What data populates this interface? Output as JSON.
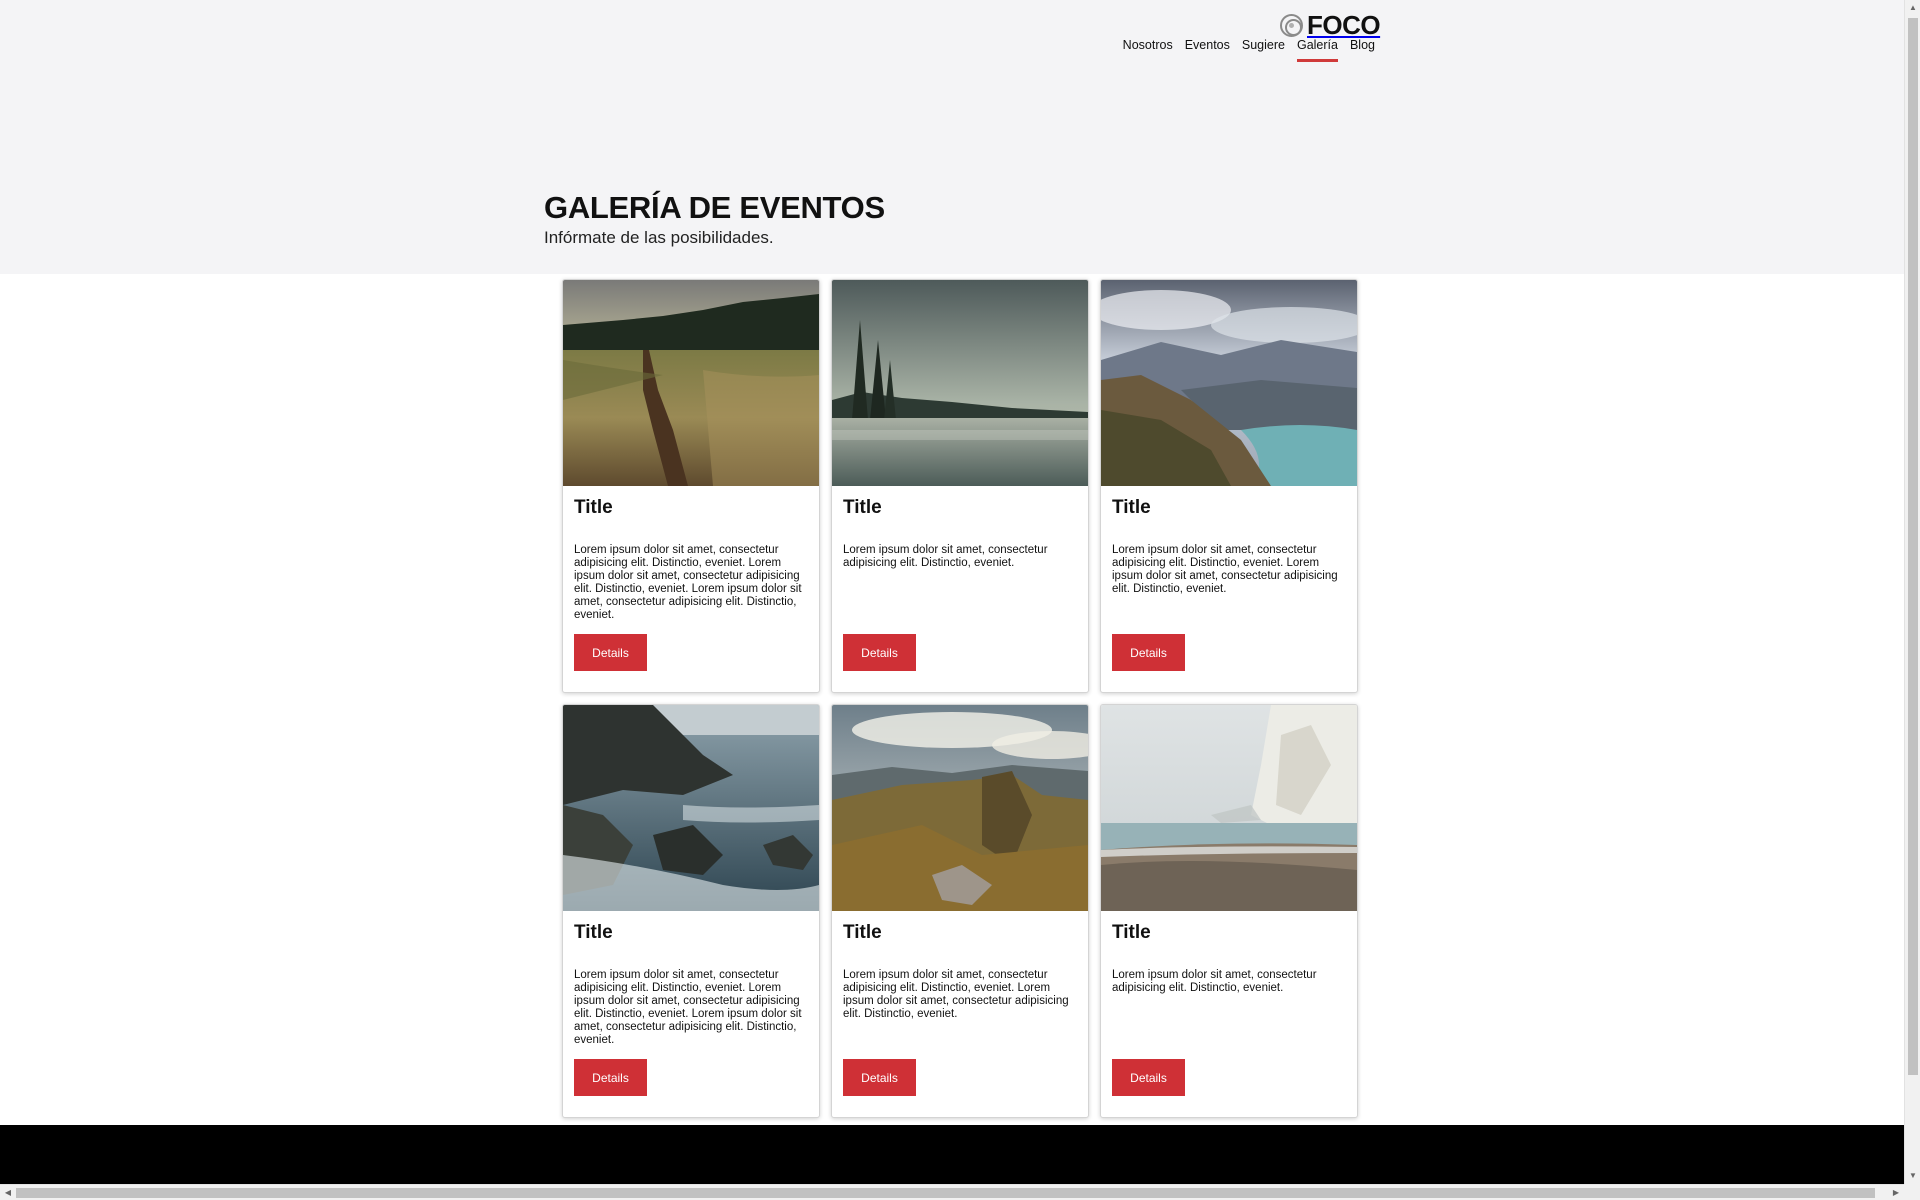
{
  "header": {
    "logo_text": "FOCO",
    "nav": [
      {
        "label": "Nosotros",
        "active": false
      },
      {
        "label": "Eventos",
        "active": false
      },
      {
        "label": "Sugiere",
        "active": false
      },
      {
        "label": "Galería",
        "active": true
      },
      {
        "label": "Blog",
        "active": false
      }
    ]
  },
  "hero": {
    "title": "GALERÍA DE EVENTOS",
    "subtitle": "Infórmate de las posibilidades."
  },
  "cards": [
    {
      "image": "meadow-path-photo",
      "title": "Title",
      "text": "Lorem ipsum dolor sit amet, consectetur adipisicing elit. Distinctio, eveniet. Lorem ipsum dolor sit amet, consectetur adipisicing elit. Distinctio, eveniet. Lorem ipsum dolor sit amet, consectetur adipisicing elit. Distinctio, eveniet.",
      "button": "Details"
    },
    {
      "image": "misty-lake-photo",
      "title": "Title",
      "text": "Lorem ipsum dolor sit amet, consectetur adipisicing elit. Distinctio, eveniet.",
      "button": "Details"
    },
    {
      "image": "mountain-river-photo",
      "title": "Title",
      "text": "Lorem ipsum dolor sit amet, consectetur adipisicing elit. Distinctio, eveniet. Lorem ipsum dolor sit amet, consectetur adipisicing elit. Distinctio, eveniet.",
      "button": "Details"
    },
    {
      "image": "rocky-coast-photo",
      "title": "Title",
      "text": "Lorem ipsum dolor sit amet, consectetur adipisicing elit. Distinctio, eveniet. Lorem ipsum dolor sit amet, consectetur adipisicing elit. Distinctio, eveniet. Lorem ipsum dolor sit amet, consectetur adipisicing elit. Distinctio, eveniet.",
      "button": "Details"
    },
    {
      "image": "hillside-valley-photo",
      "title": "Title",
      "text": "Lorem ipsum dolor sit amet, consectetur adipisicing elit. Distinctio, eveniet. Lorem ipsum dolor sit amet, consectetur adipisicing elit. Distinctio, eveniet.",
      "button": "Details"
    },
    {
      "image": "white-cliff-beach-photo",
      "title": "Title",
      "text": "Lorem ipsum dolor sit amet, consectetur adipisicing elit. Distinctio, eveniet.",
      "button": "Details"
    }
  ],
  "colors": {
    "accent": "#cf3036",
    "hero_bg": "#f4f4f6",
    "footer_bg": "#000000"
  }
}
